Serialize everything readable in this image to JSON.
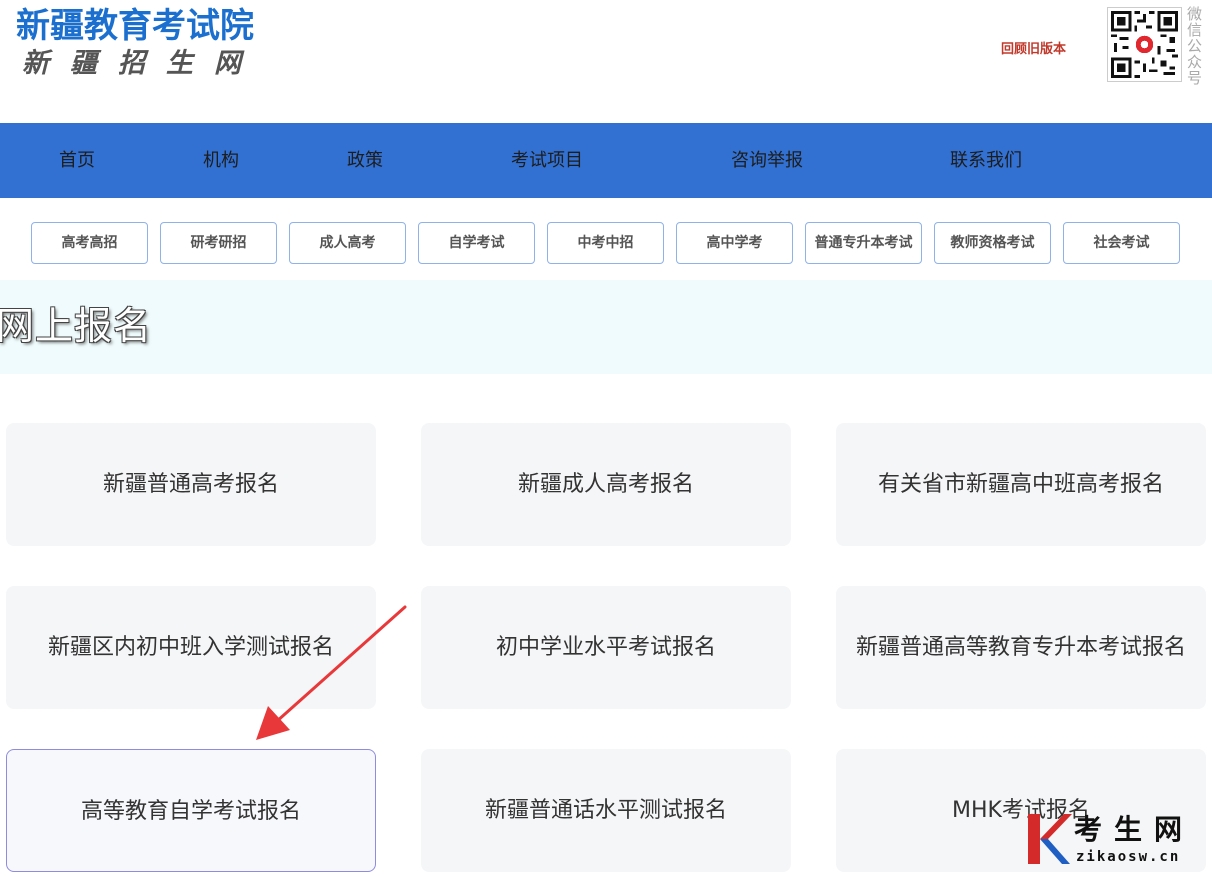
{
  "header": {
    "title": "新疆教育考试院",
    "subtitle": "新疆招生网",
    "old_version": "回顾旧版本",
    "qr_label": "微信公众号"
  },
  "nav": {
    "items": [
      {
        "label": "首页"
      },
      {
        "label": "机构"
      },
      {
        "label": "政策"
      },
      {
        "label": "考试项目"
      },
      {
        "label": "咨询举报"
      },
      {
        "label": "联系我们"
      }
    ]
  },
  "categories": [
    {
      "label": "高考高招"
    },
    {
      "label": "研考研招"
    },
    {
      "label": "成人高考"
    },
    {
      "label": "自学考试"
    },
    {
      "label": "中考中招"
    },
    {
      "label": "高中学考"
    },
    {
      "label": "普通专升本考试"
    },
    {
      "label": "教师资格考试"
    },
    {
      "label": "社会考试"
    }
  ],
  "banner": {
    "title": "网上报名"
  },
  "cards": [
    {
      "label": "新疆普通高考报名"
    },
    {
      "label": "新疆成人高考报名"
    },
    {
      "label": "有关省市新疆高中班高考报名"
    },
    {
      "label": "新疆区内初中班入学测试报名"
    },
    {
      "label": "初中学业水平考试报名"
    },
    {
      "label": "新疆普通高等教育专升本考试报名"
    },
    {
      "label": "高等教育自学考试报名"
    },
    {
      "label": "新疆普通话水平测试报名"
    },
    {
      "label": "MHK考试报名"
    }
  ],
  "watermark": {
    "title": "考生网",
    "url": "zikaosw.cn"
  },
  "colors": {
    "brand_blue": "#1a6fcf",
    "nav_bg": "#3271d1",
    "banner_bg": "#effbfc",
    "card_bg": "#f5f6f8",
    "arrow": "#e8383a",
    "old_version": "#c0392b"
  }
}
